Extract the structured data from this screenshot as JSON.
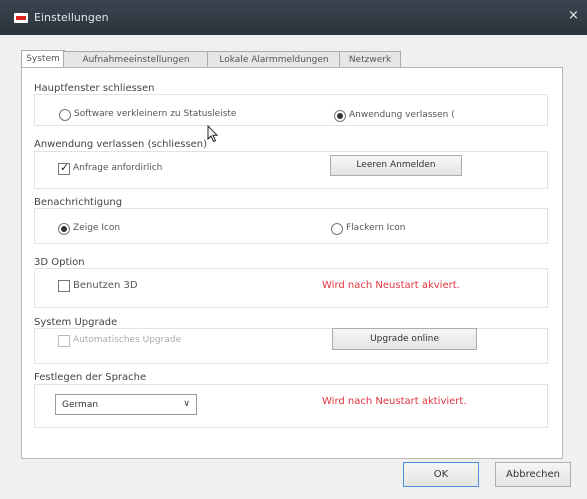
{
  "window": {
    "title": "Einstellungen",
    "close_glyph": "×",
    "icon": "app-logo-icon"
  },
  "tabs": [
    {
      "label": "System",
      "active": true
    },
    {
      "label": "Aufnahmeeinstellungen",
      "active": false
    },
    {
      "label": "Lokale Alarmmeldungen",
      "active": false
    },
    {
      "label": "Netzwerk",
      "active": false
    }
  ],
  "groups": {
    "main_window": {
      "title": "Hauptfenster schliessen",
      "option_minimize": "Software verkleinern zu Statusleiste",
      "option_exit": "Anwendung verlassen (",
      "selected": "option_exit"
    },
    "exit_app": {
      "title": "Anwendung verlassen (schliessen)",
      "checkbox_label": "Anfrage anfordirlich",
      "checked": true,
      "button_label": "Leeren Anmelden"
    },
    "notification": {
      "title": "Benachrichtigung",
      "option_show": "Zeige Icon",
      "option_flash": "Flackern Icon",
      "selected": "option_show"
    },
    "option_3d": {
      "title": "3D Option",
      "checkbox_label": "Benutzen 3D",
      "checked": false,
      "notice": "Wird nach Neustart akviert."
    },
    "upgrade": {
      "title": "System Upgrade",
      "checkbox_label": "Automatisches Upgrade",
      "checked": false,
      "disabled": true,
      "button_label": "Upgrade online"
    },
    "language": {
      "title": "Festlegen der Sprache",
      "selected_value": "German",
      "dropdown_glyph": "∨",
      "notice": "Wird nach Neustart aktiviert."
    }
  },
  "footer": {
    "ok_label": "OK",
    "cancel_label": "Abbrechen"
  },
  "colors": {
    "titlebar": "#2b343c",
    "notice_red": "#e0353d",
    "panel_bg": "#ffffff"
  }
}
